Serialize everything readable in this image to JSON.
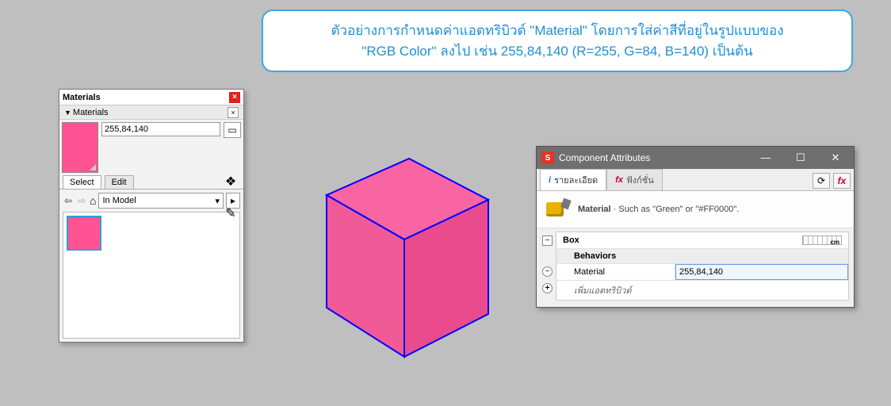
{
  "callout": {
    "line1": "ตัวอย่างการกำหนดค่าแอตทริบิวต์ \"Material\" โดยการใส่ค่าสีที่อยู่ในรูปแบบของ",
    "line2": "\"RGB Color\" ลงไป เช่น 255,84,140 (R=255, G=84, B=140) เป็นต้น"
  },
  "materialsPanel": {
    "title": "Materials",
    "section": "Materials",
    "colorName": "255,84,140",
    "tabs": {
      "select": "Select",
      "edit": "Edit"
    },
    "dropdown": "In Model",
    "swatchColor": "#ff5393"
  },
  "cube": {
    "faceTop": "#f865a2",
    "faceLeft": "#f05a97",
    "faceRight": "#e94b8c",
    "edge": "#0000ff"
  },
  "attrWin": {
    "title": "Component Attributes",
    "tabDetails": "รายละเอียด",
    "tabFunctions": "ฟังก์ชั่น",
    "hintLabel": "Material",
    "hintText": "· Such as \"Green\" or \"#FF0000\".",
    "groupName": "Box",
    "unit": "cm",
    "behaviors": "Behaviors",
    "attrName": "Material",
    "attrValue": "255,84,140",
    "addAttr": "เพิ่มแอตทริบิวต์"
  }
}
